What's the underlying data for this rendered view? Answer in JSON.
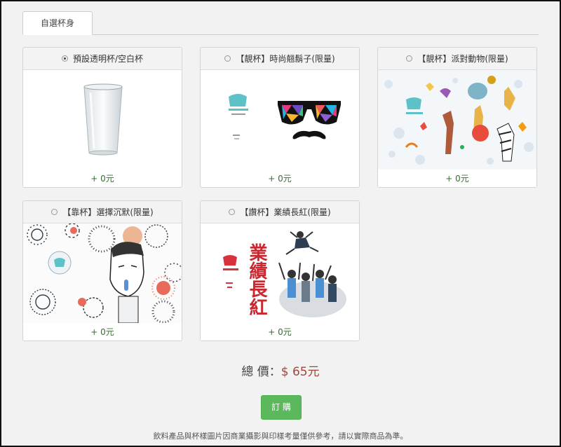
{
  "tabs": [
    {
      "label": "自選杯身"
    }
  ],
  "cards": [
    {
      "title": "預設透明杯/空白杯",
      "price": "+ 0元",
      "selected": true
    },
    {
      "title": "【靚杯】時尚翹鬍子(限量)",
      "price": "+ 0元",
      "selected": false
    },
    {
      "title": "【靚杯】派對動物(限量)",
      "price": "+ 0元",
      "selected": false
    },
    {
      "title": "【靠杯】選擇沉默(限量)",
      "price": "+ 0元",
      "selected": false
    },
    {
      "title": "【讚杯】業績長紅(限量)",
      "price": "+ 0元",
      "selected": false,
      "art_text": "業績長紅"
    }
  ],
  "total": {
    "label": "總 價：",
    "amount": "$ 65元"
  },
  "order_button": "訂 購",
  "note": "飲料產品與杯樣圖片因商業攝影與印樣考量僅供參考，請以實際商品為準。",
  "colors": {
    "accent_green": "#5cb85c",
    "price_green": "#3a6b34",
    "total_red": "#a0473d"
  }
}
